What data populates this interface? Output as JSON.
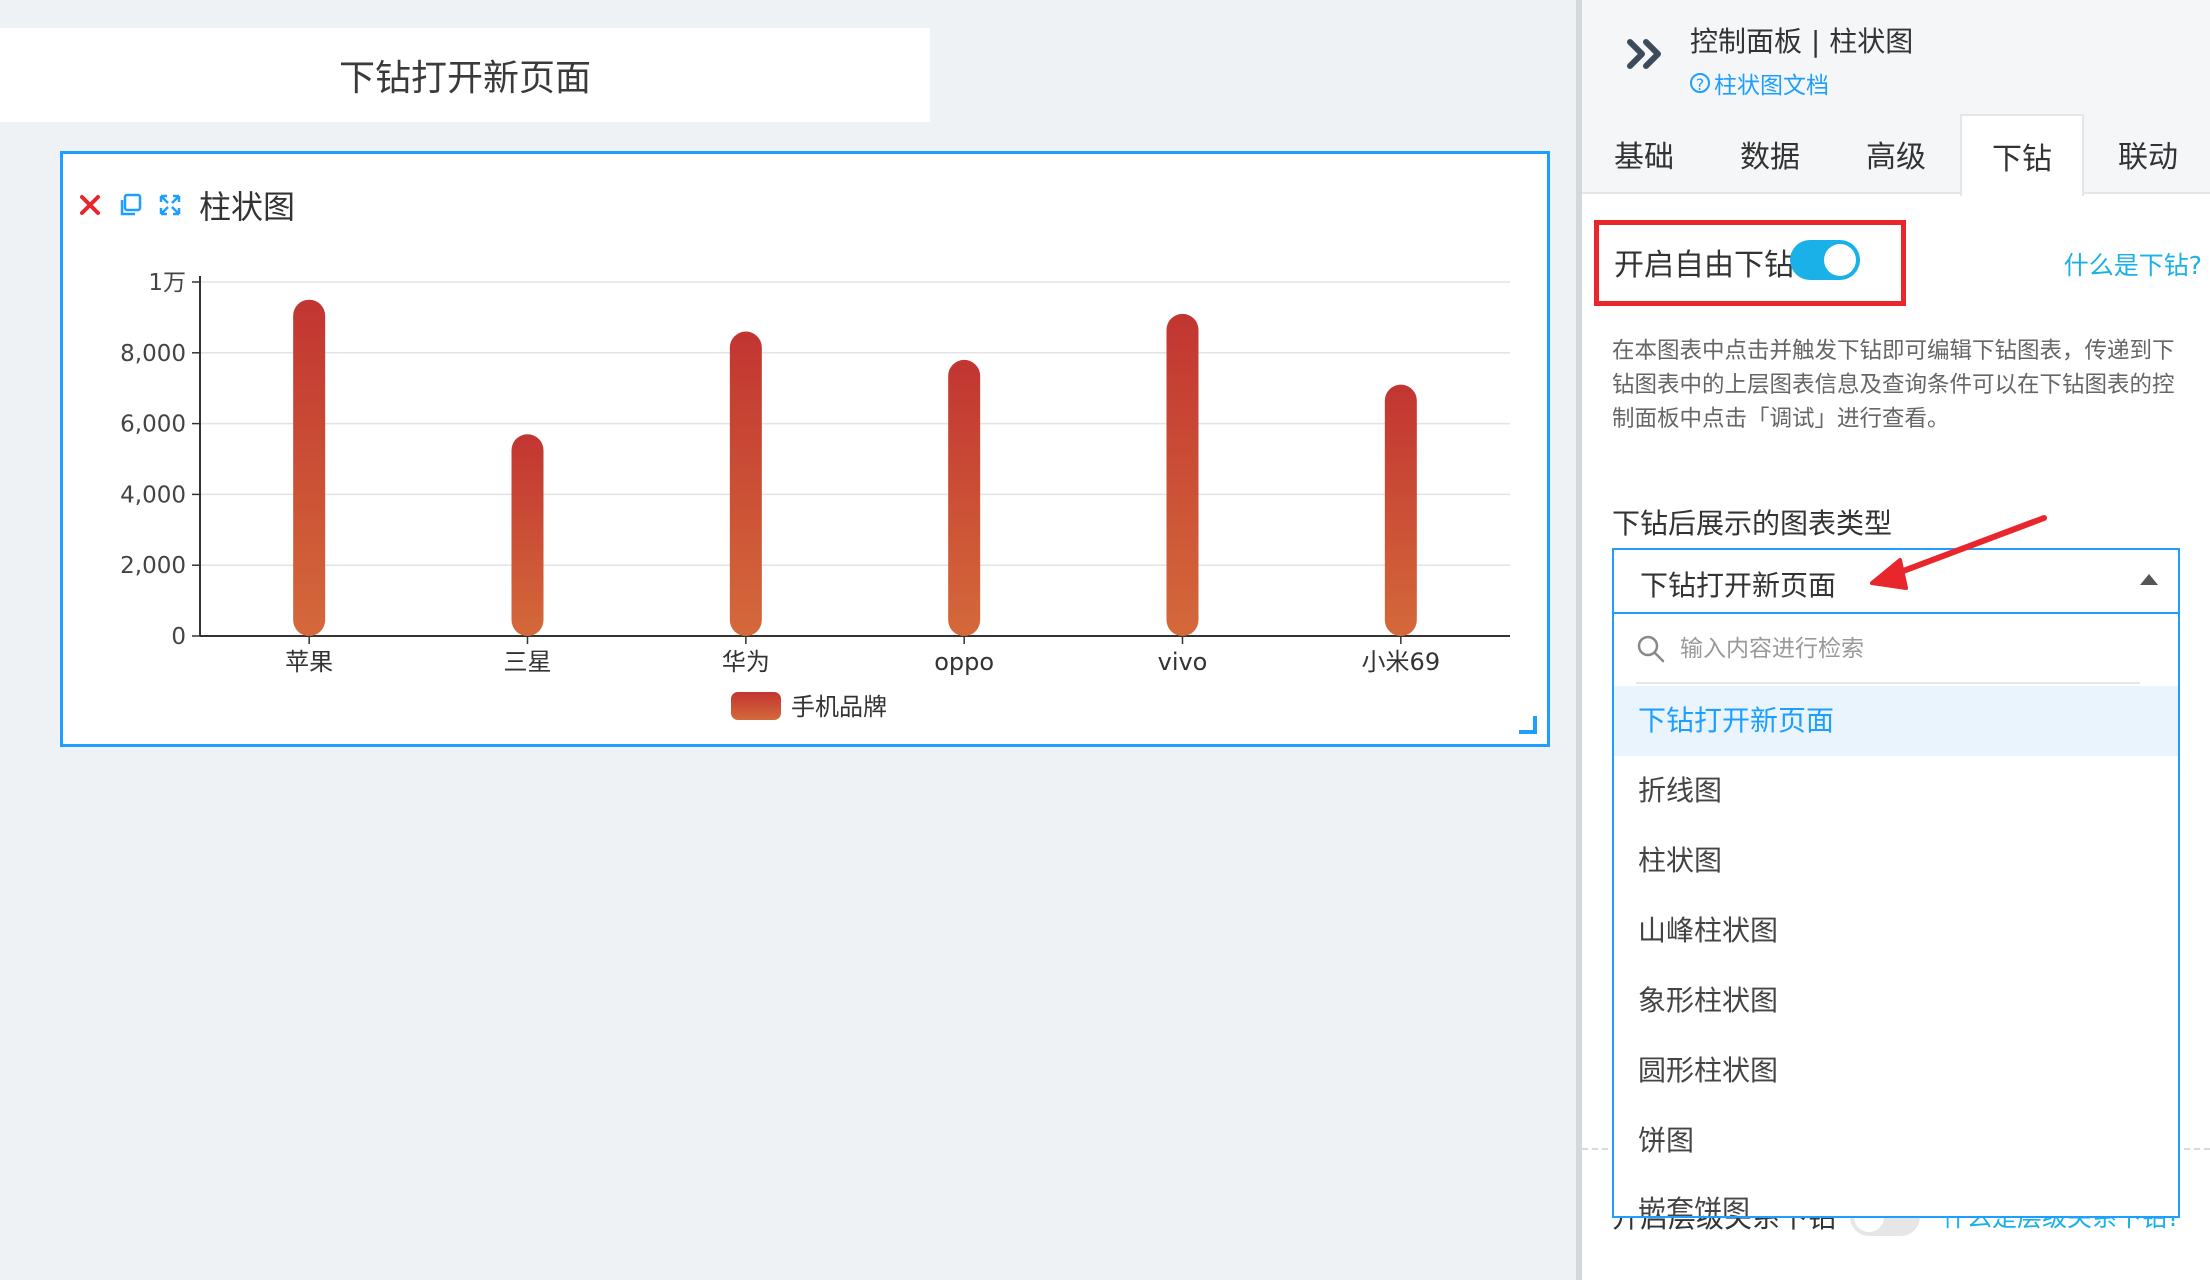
{
  "canvas": {
    "title_card": "下钻打开新页面",
    "widget": {
      "title": "柱状图",
      "toolbar": [
        "close-icon",
        "copy-icon",
        "fullscreen-icon"
      ]
    }
  },
  "chart_data": {
    "type": "bar",
    "categories": [
      "苹果",
      "三星",
      "华为",
      "oppo",
      "vivo",
      "小米69"
    ],
    "series": [
      {
        "name": "手机品牌",
        "values": [
          9500,
          5700,
          8600,
          7800,
          9100,
          7100
        ]
      }
    ],
    "yticks": [
      "0",
      "2,000",
      "4,000",
      "6,000",
      "8,000",
      "1万"
    ],
    "ylim": [
      0,
      10000
    ],
    "grid": true,
    "legend": "bottom-center",
    "bar_gradient": [
      "#c23531",
      "#d4693a"
    ]
  },
  "panel": {
    "title": "控制面板 | 柱状图",
    "doc_link": "柱状图文档",
    "tabs": [
      {
        "label": "基础",
        "active": false
      },
      {
        "label": "数据",
        "active": false
      },
      {
        "label": "高级",
        "active": false
      },
      {
        "label": "下钻",
        "active": true
      },
      {
        "label": "联动",
        "active": false
      }
    ],
    "drill": {
      "label": "开启自由下钻",
      "enabled": true,
      "help": "什么是下钻?",
      "description": "在本图表中点击并触发下钻即可编辑下钻图表，传递到下钻图表中的上层图表信息及查询条件可以在下钻图表的控制面板中点击「调试」进行查看。"
    },
    "type_select": {
      "label": "下钻后展示的图表类型",
      "value": "下钻打开新页面",
      "search_placeholder": "输入内容进行检索",
      "options": [
        "下钻打开新页面",
        "折线图",
        "柱状图",
        "山峰柱状图",
        "象形柱状图",
        "圆形柱状图",
        "饼图",
        "嵌套饼图"
      ]
    },
    "level_drill": {
      "label": "开启层级关系下钻",
      "enabled": false,
      "help": "什么是层级关系下钻?"
    }
  },
  "colors": {
    "accent": "#1e9fff",
    "toggle_on": "#1ab0e8",
    "highlight": "#e8262b"
  }
}
